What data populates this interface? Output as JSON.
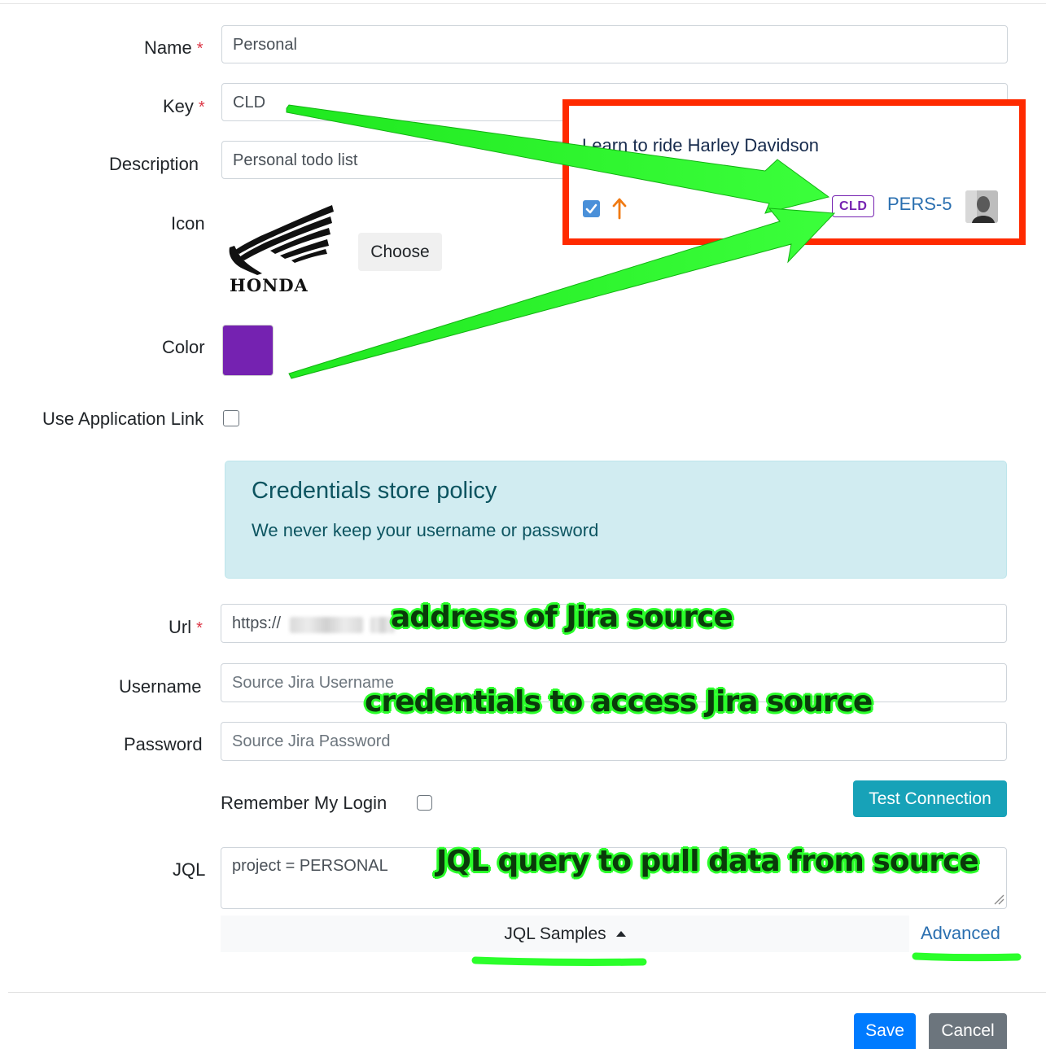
{
  "form": {
    "name": {
      "label": "Name",
      "required": "*",
      "value": "Personal"
    },
    "key": {
      "label": "Key",
      "required": "*",
      "value": "CLD"
    },
    "description": {
      "label": "Description",
      "value": "Personal todo list"
    },
    "icon": {
      "label": "Icon",
      "brand": "HONDA",
      "choose_label": "Choose"
    },
    "color": {
      "label": "Color",
      "value": "#7522b1"
    },
    "app_link": {
      "label": "Use Application Link",
      "checked": false
    },
    "alert": {
      "title": "Credentials store policy",
      "body": "We never keep your username or password"
    },
    "url": {
      "label": "Url",
      "required": "*",
      "value": "https://"
    },
    "username": {
      "label": "Username",
      "placeholder": "Source Jira Username"
    },
    "password": {
      "label": "Password",
      "placeholder": "Source Jira Password"
    },
    "remember": {
      "label": "Remember My Login",
      "checked": false
    },
    "test_connection_label": "Test Connection",
    "jql": {
      "label": "JQL",
      "value": "project = PERSONAL"
    },
    "jql_samples_label": "JQL Samples",
    "advanced_label": "Advanced"
  },
  "footer": {
    "save_label": "Save",
    "cancel_label": "Cancel"
  },
  "preview": {
    "title": "Learn to ride Harley Davidson",
    "badge": "CLD",
    "issue_key": "PERS-5",
    "checked": true
  },
  "annotations": {
    "url_note": "address of Jira source",
    "credentials_note": "credentials to access Jira source",
    "jql_note": "JQL query to pull data from source"
  },
  "colors": {
    "accent_primary": "#007bff",
    "accent_info": "#17a2b8",
    "annotation_green": "#2bff2b",
    "callout_red": "#ff2a00",
    "project_color": "#7522b1"
  }
}
